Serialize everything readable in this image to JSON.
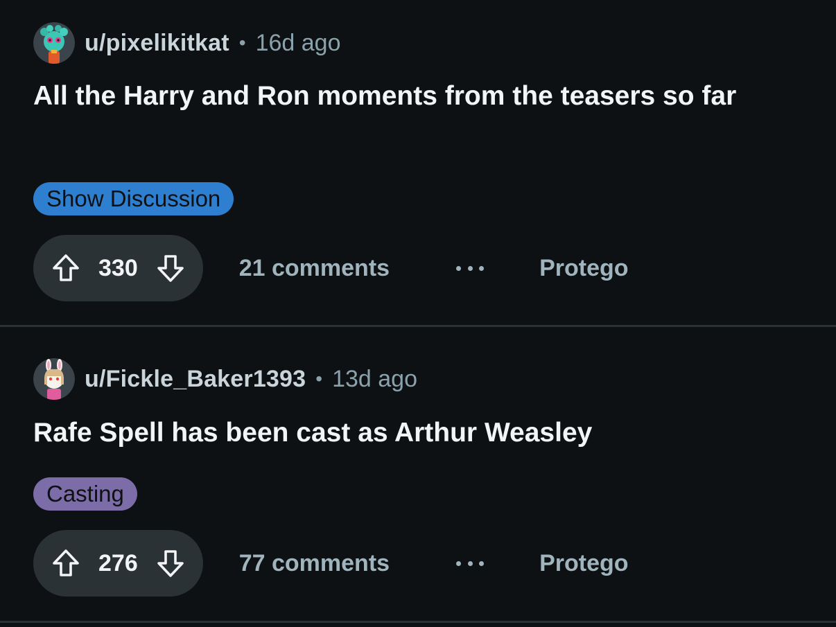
{
  "colors": {
    "background": "#0e1113",
    "pill": "#2a3236",
    "flair_show_discussion": "#2f7fd0",
    "flair_casting": "#7c6ca8",
    "muted_text": "#9fb4bd"
  },
  "posts": [
    {
      "username": "u/pixelikitkat",
      "separator": "•",
      "time": "16d ago",
      "avatar_icon": "snoo-avatar-teal-icon",
      "title": "All the Harry and Ron moments from the teasers so far",
      "flair": "Show Discussion",
      "score": "330",
      "comments": "21 comments",
      "more_icon": "ellipsis-icon",
      "community": "Protego"
    },
    {
      "username": "u/Fickle_Baker1393",
      "separator": "•",
      "time": "13d ago",
      "avatar_icon": "snoo-avatar-bunny-icon",
      "title": "Rafe Spell has been cast as Arthur Weasley",
      "flair": "Casting",
      "score": "276",
      "comments": "77 comments",
      "more_icon": "ellipsis-icon",
      "community": "Protego"
    }
  ]
}
